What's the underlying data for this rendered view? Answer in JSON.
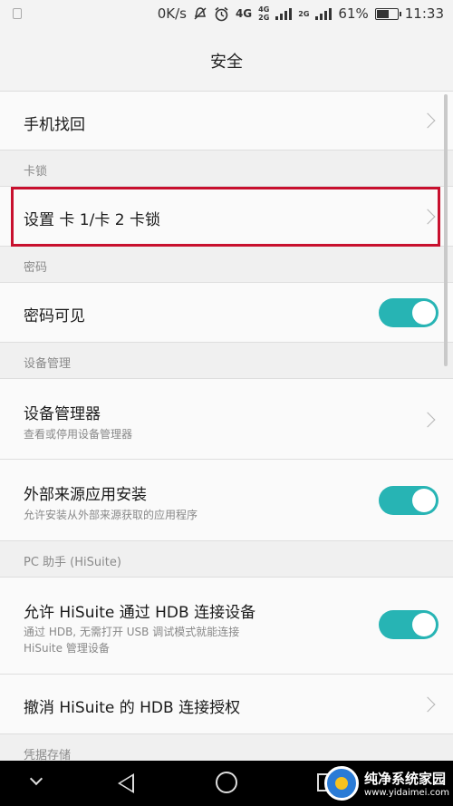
{
  "statusbar": {
    "speed": "0K/s",
    "net_4g": "4G",
    "net_top": "4G",
    "net_bottom": "2G",
    "net_2g": "2G",
    "battery": "61%",
    "battery_level": 0.61,
    "time": "11:33"
  },
  "header": {
    "title": "安全"
  },
  "rows": {
    "find_phone": {
      "title": "手机找回"
    },
    "sim_section": "卡锁",
    "sim_lock": {
      "title": "设置 卡 1/卡 2 卡锁"
    },
    "password_section": "密码",
    "password_visible": {
      "title": "密码可见",
      "on": true
    },
    "device_section": "设备管理",
    "device_admin": {
      "title": "设备管理器",
      "subtitle": "查看或停用设备管理器"
    },
    "unknown_sources": {
      "title": "外部来源应用安装",
      "subtitle": "允许安装从外部来源获取的应用程序",
      "on": true
    },
    "pc_section": "PC 助手 (HiSuite)",
    "hisuite_hdb": {
      "title": "允许 HiSuite 通过 HDB 连接设备",
      "subtitle_line1": "通过 HDB, 无需打开 USB 调试模式就能连接",
      "subtitle_line2": "HiSuite 管理设备",
      "on": true
    },
    "revoke_hdb": {
      "title": "撤消 HiSuite 的 HDB 连接授权"
    },
    "credential_section": "凭据存储"
  },
  "watermark": {
    "title": "纯净系统家园",
    "url": "www.yidaimei.com"
  },
  "colors": {
    "toggle_on": "#27b4b4",
    "highlight": "#c8102e",
    "background": "#f3f3f3"
  },
  "icons": [
    "notification-icon",
    "mute-icon",
    "alarm-icon",
    "signal-icon",
    "battery-icon",
    "chevron-right-icon",
    "nav-down-icon",
    "nav-back-icon",
    "nav-home-icon",
    "nav-recent-icon"
  ]
}
